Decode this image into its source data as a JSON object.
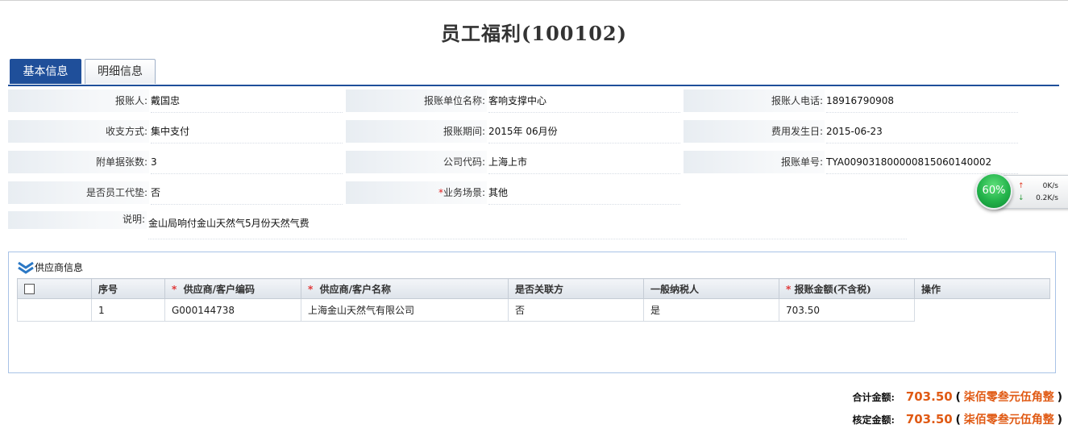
{
  "page": {
    "title": "员工福利(100102)"
  },
  "tabs": [
    {
      "label": "基本信息",
      "active": true
    },
    {
      "label": "明细信息",
      "active": false
    }
  ],
  "form": {
    "claimant_label": "报账人:",
    "claimant": "戴国忠",
    "unit_label": "报账单位名称:",
    "unit": "客响支撑中心",
    "phone_label": "报账人电话:",
    "phone": "18916790908",
    "payment_label": "收支方式:",
    "payment": "集中支付",
    "period_label": "报账期间:",
    "period": "2015年 06月份",
    "date_label": "费用发生日:",
    "date": "2015-06-23",
    "attachments_label": "附单据张数:",
    "attachments": "3",
    "company_label": "公司代码:",
    "company": "上海上市",
    "docno_label": "报账单号:",
    "docno": "TYA009031800000815060140002",
    "advance_label": "是否员工代垫:",
    "advance": "否",
    "scenario_required": "*",
    "scenario_label": "业务场景:",
    "scenario": "其他",
    "desc_label": "说明:",
    "desc": "金山局响付金山天然气5月份天然气费"
  },
  "net_widget": {
    "percent": "60%",
    "up": "0K/s",
    "down": "0.2K/s",
    "up_arrow": "↑",
    "down_arrow": "↓",
    "plus": "+"
  },
  "supplier": {
    "title": "供应商信息",
    "columns": [
      {
        "label": "",
        "required": false
      },
      {
        "label": "序号",
        "required": false
      },
      {
        "label": "供应商/客户编码",
        "required": true
      },
      {
        "label": "供应商/客户名称",
        "required": true
      },
      {
        "label": "是否关联方",
        "required": false
      },
      {
        "label": "一般纳税人",
        "required": false
      },
      {
        "label": "报账金额(不含税)",
        "required": true
      },
      {
        "label": "操作",
        "required": false
      }
    ],
    "required_mark": "*",
    "rows": [
      {
        "no": "1",
        "code": "G000144738",
        "name": "上海金山天然气有限公司",
        "related": "否",
        "taxpayer": "是",
        "amount": "703.50"
      }
    ]
  },
  "totals": {
    "total_label": "合计金额:",
    "total_value": "703.50",
    "approved_label": "核定金额:",
    "approved_value": "703.50",
    "paren_open": "(",
    "paren_close": ")",
    "chinese_amount": "柒佰零叁元伍角整"
  },
  "colors": {
    "accent": "#1f4f9a",
    "amount": "#e05a14",
    "required": "#e02020"
  }
}
